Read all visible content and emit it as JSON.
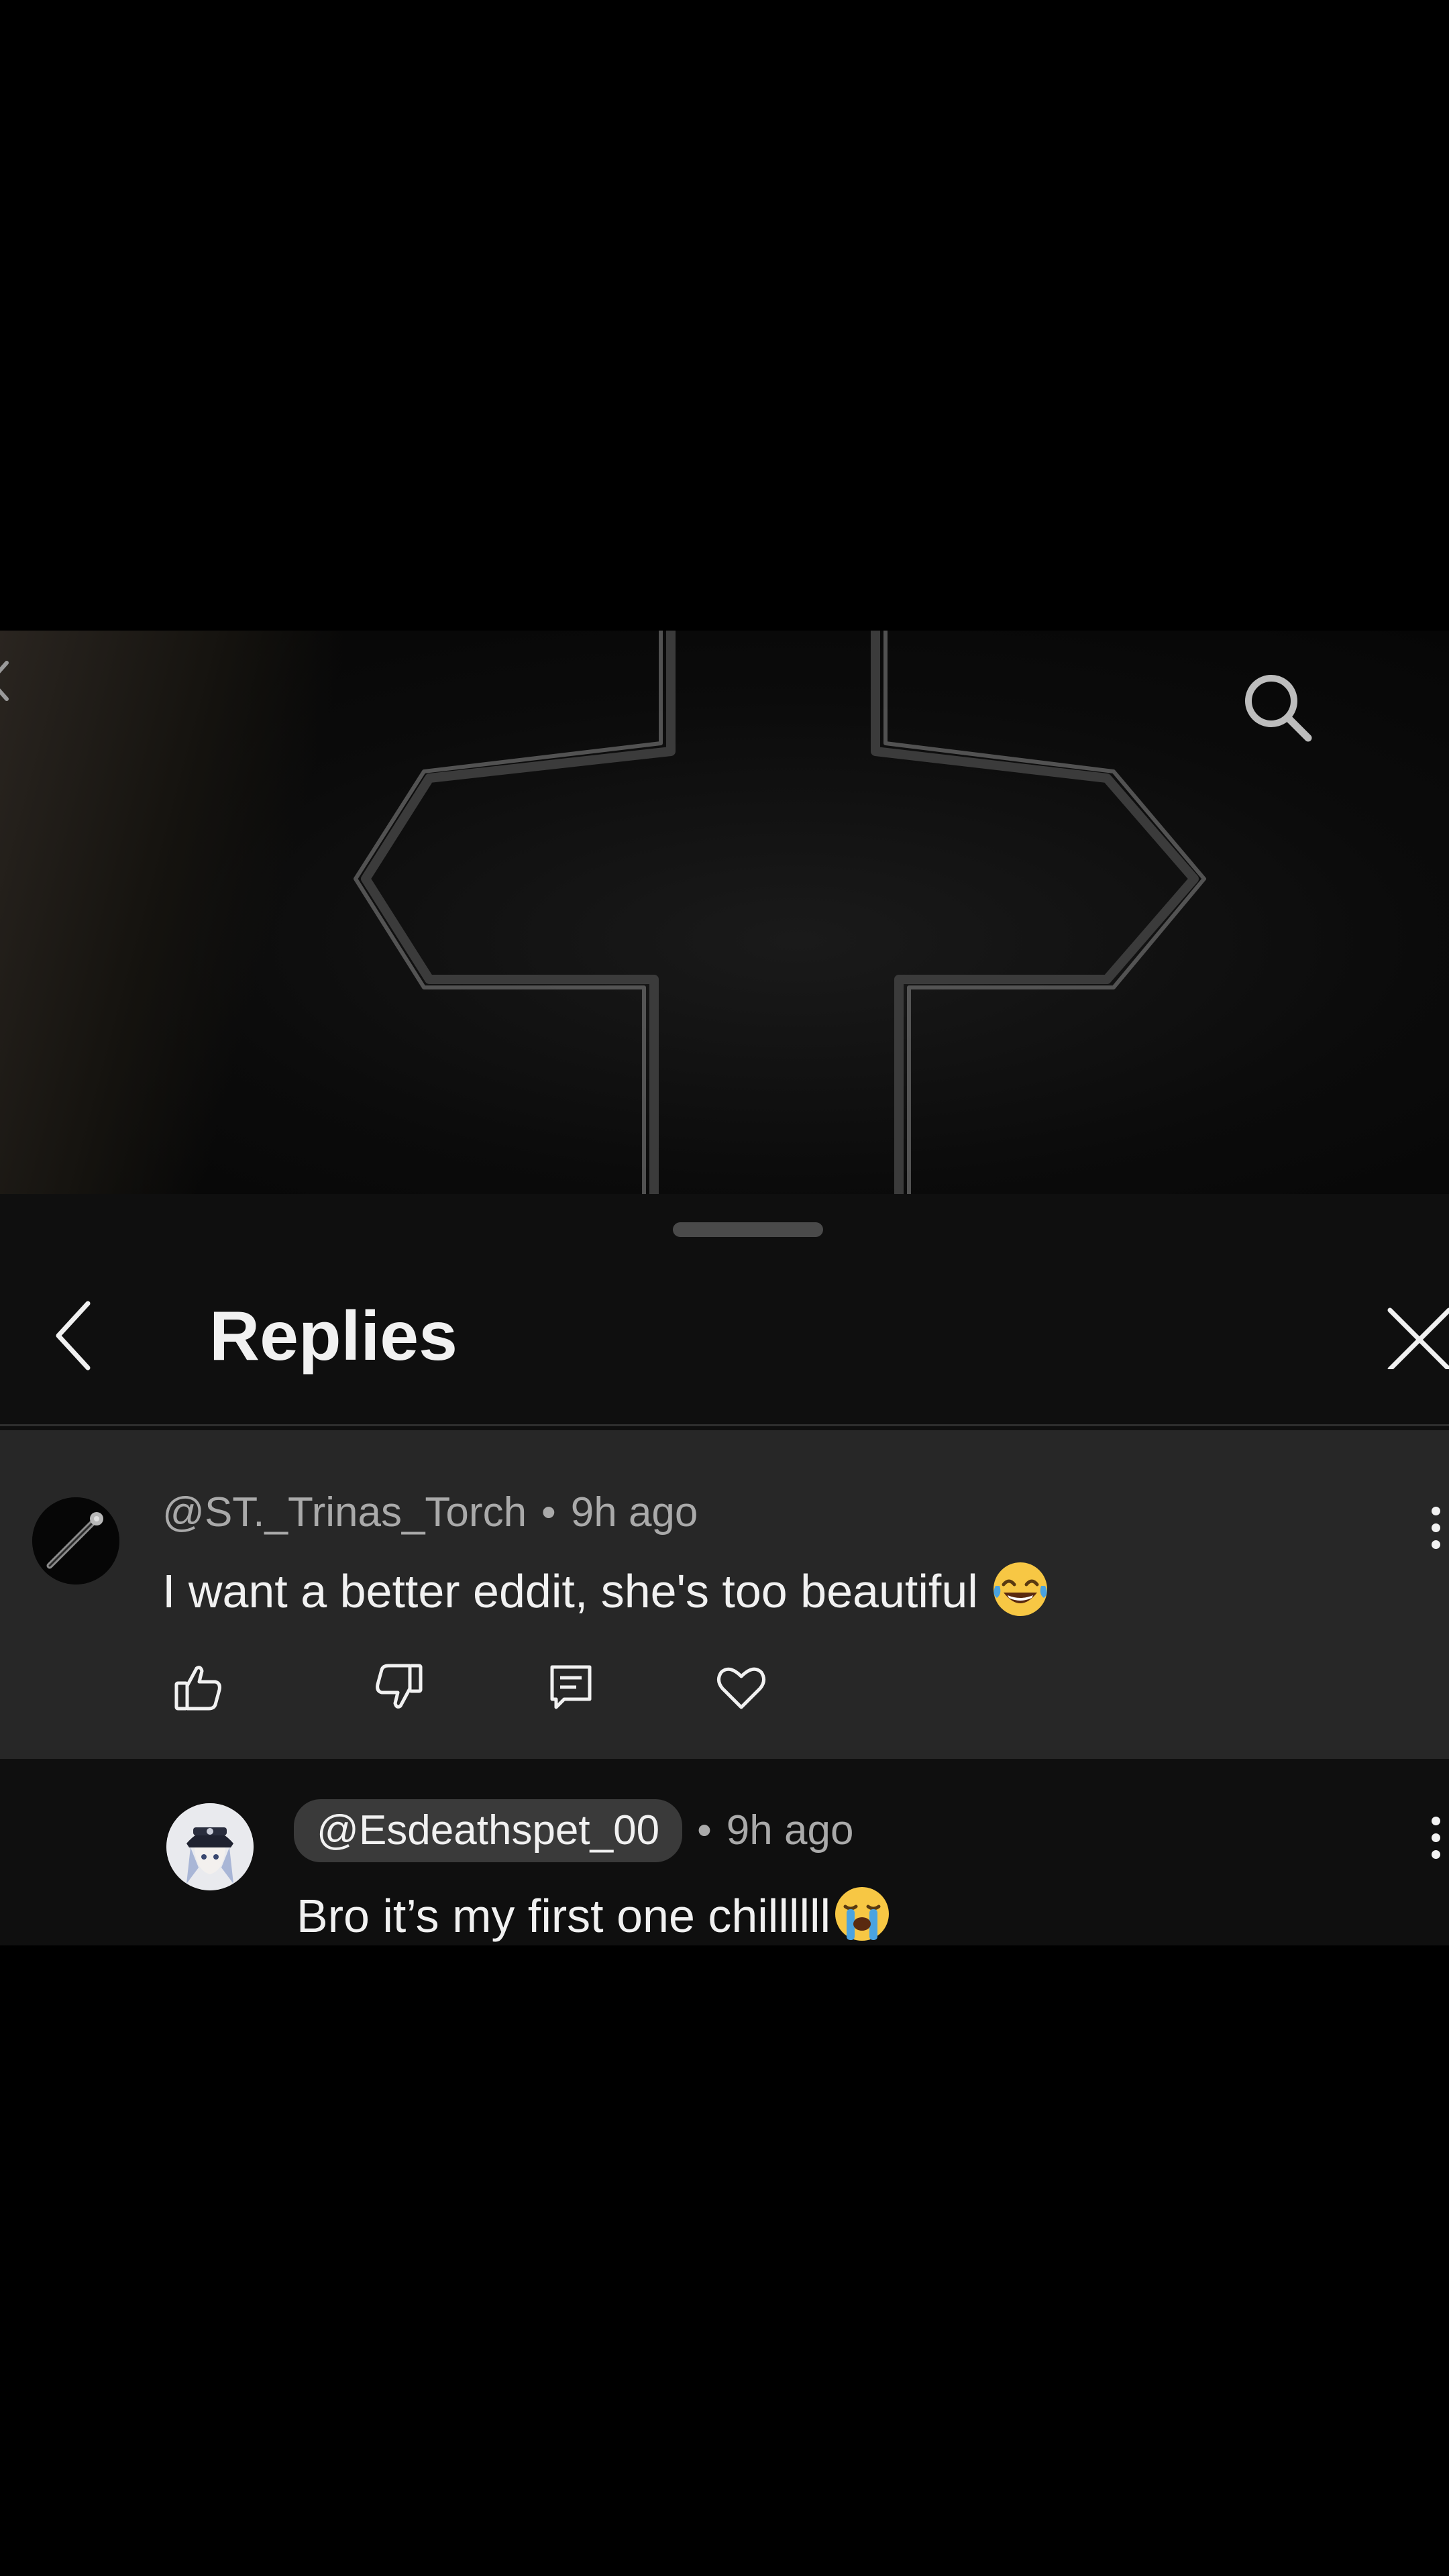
{
  "sheet": {
    "title": "Replies"
  },
  "comment": {
    "username": "@ST._Trinas_Torch",
    "separator": "•",
    "time": "9h ago",
    "text": "I want a better eddit, she's too beautiful",
    "emoji": "face-with-tears-of-joy"
  },
  "reply": {
    "username": "@Esdeathspet_00",
    "separator": "•",
    "time": "9h ago",
    "text": "Bro it’s my first one chillllll",
    "emoji": "loudly-crying-face"
  },
  "icons": {
    "video_back": "chevron-left-icon",
    "search": "search-icon",
    "sheet_back": "chevron-left-icon",
    "close": "close-icon",
    "like": "thumbs-up-icon",
    "dislike": "thumbs-down-icon",
    "reply": "comment-icon",
    "heart": "heart-icon",
    "more": "more-vertical-icon"
  },
  "colors": {
    "sheet_bg": "#0f0f0f",
    "highlight_bg": "#272727",
    "meta_text": "#aaaaaa",
    "primary_text": "#f1f1f1",
    "mention_bg": "#3a3a3a"
  }
}
